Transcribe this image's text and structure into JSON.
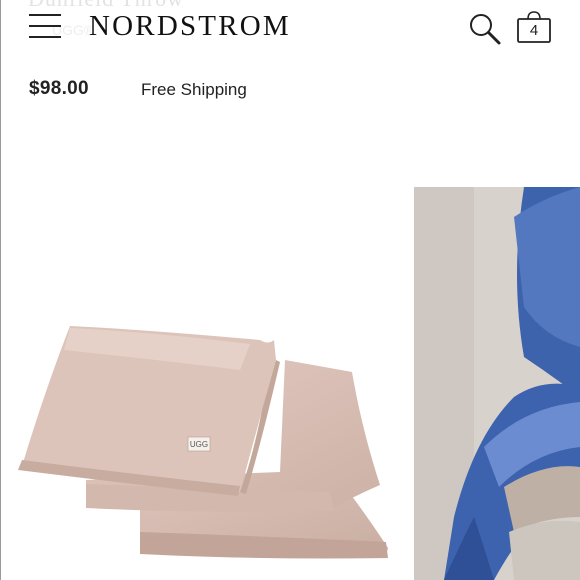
{
  "header": {
    "logo": "NORDSTROM",
    "bag_count": "4",
    "icons": [
      "menu-icon",
      "search-icon",
      "shopping-bag-icon"
    ]
  },
  "product": {
    "title": "Dunfield Throw",
    "brand": "UGG®",
    "price": "$98.00",
    "shipping": "Free Shipping",
    "tag_label": "UGG"
  },
  "colors": {
    "text": "#222222",
    "throw_taupe": "#d9c2b8",
    "throw_blue": "#4f72b8"
  }
}
